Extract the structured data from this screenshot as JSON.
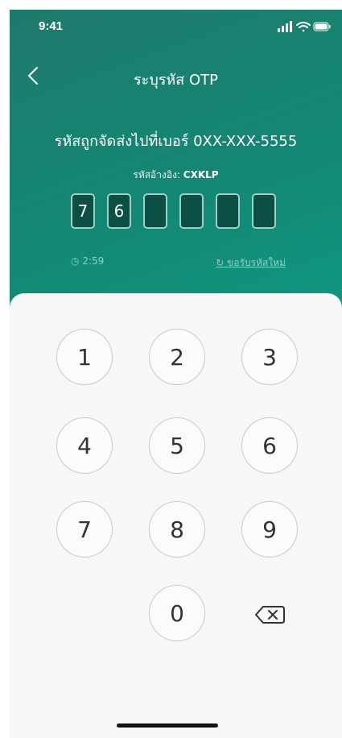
{
  "status_bar": {
    "time": "9:41"
  },
  "nav": {
    "title": "ระบุรหัส OTP"
  },
  "message": "รหัสถูกจัดส่งไปที่เบอร์ 0XX-XXX-5555",
  "reference": {
    "label": "รหัสอ้างอิง: ",
    "code": "CXKLP"
  },
  "otp": {
    "digits": [
      "7",
      "6",
      "",
      "",
      "",
      ""
    ]
  },
  "timer": {
    "text": "2:59"
  },
  "resend": {
    "label": "ขอรับรหัสใหม่"
  },
  "keypad": {
    "keys": [
      "1",
      "2",
      "3",
      "4",
      "5",
      "6",
      "7",
      "8",
      "9",
      "0"
    ]
  },
  "colors": {
    "header_start": "#1f7a6c",
    "header_end": "#0f9a83",
    "otp_box": "#0b4f45"
  }
}
